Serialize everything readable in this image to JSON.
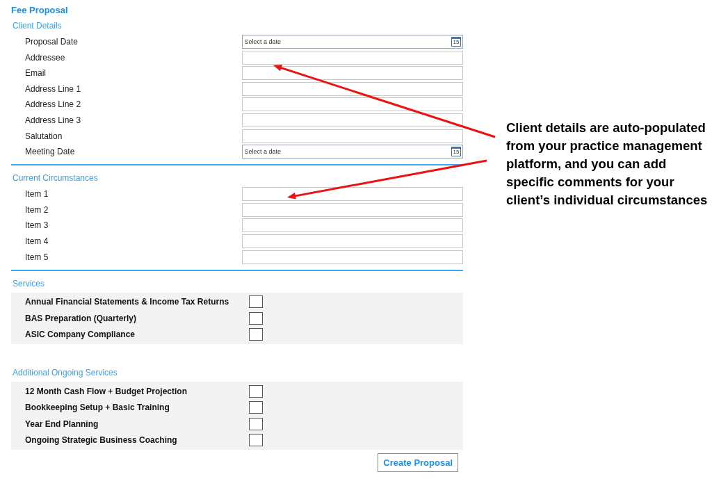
{
  "title": "Fee Proposal",
  "sections": [
    {
      "heading": "Client Details",
      "kind": "fields",
      "fields": [
        {
          "label": "Proposal Date",
          "kind": "date",
          "placeholder": "Select a date",
          "icon_text": "15"
        },
        {
          "label": "Addressee",
          "kind": "text"
        },
        {
          "label": "Email",
          "kind": "text"
        },
        {
          "label": "Address Line 1",
          "kind": "text"
        },
        {
          "label": "Address Line 2",
          "kind": "text"
        },
        {
          "label": "Address Line 3",
          "kind": "text"
        },
        {
          "label": "Salutation",
          "kind": "text"
        },
        {
          "label": "Meeting Date",
          "kind": "date",
          "placeholder": "Select a date",
          "icon_text": "15"
        }
      ]
    },
    {
      "heading": "Current Circumstances",
      "kind": "fields",
      "fields": [
        {
          "label": "Item 1",
          "kind": "text"
        },
        {
          "label": "Item 2",
          "kind": "text"
        },
        {
          "label": "Item 3",
          "kind": "text"
        },
        {
          "label": "Item 4",
          "kind": "text"
        },
        {
          "label": "Item 5",
          "kind": "text"
        }
      ]
    },
    {
      "heading": "Services",
      "kind": "checks",
      "options": [
        {
          "label": "Annual Financial Statements & Income Tax Returns",
          "checked": false
        },
        {
          "label": "BAS Preparation (Quarterly)",
          "checked": false
        },
        {
          "label": "ASIC Company Compliance",
          "checked": false
        }
      ]
    },
    {
      "heading": "Additional Ongoing Services",
      "kind": "checks",
      "options": [
        {
          "label": "12 Month Cash Flow + Budget Projection",
          "checked": false
        },
        {
          "label": "Bookkeeping Setup + Basic Training",
          "checked": false
        },
        {
          "label": "Year End Planning",
          "checked": false
        },
        {
          "label": "Ongoing Strategic Business Coaching",
          "checked": false
        }
      ]
    }
  ],
  "button": "Create Proposal",
  "annotation": "Client details are auto-populated from your practice management platform, and you can add specific comments for your client’s individual circumstances"
}
